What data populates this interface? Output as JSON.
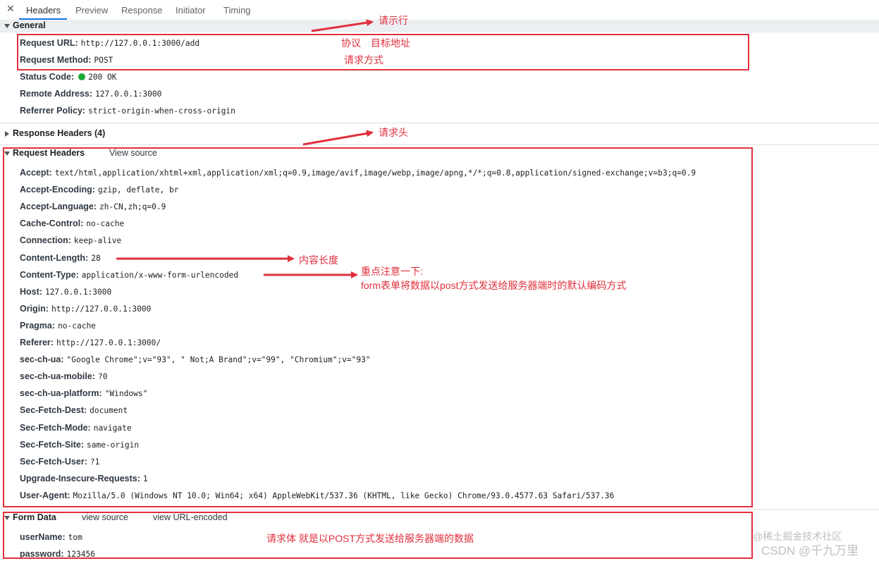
{
  "tabs": {
    "close_glyph": "✕",
    "items": [
      "Headers",
      "Preview",
      "Response",
      "Initiator",
      "Timing"
    ]
  },
  "general": {
    "title": "General",
    "rows": [
      {
        "key": "Request URL:",
        "value": "http://127.0.0.1:3000/add"
      },
      {
        "key": "Request Method:",
        "value": "POST"
      },
      {
        "key": "Status Code:",
        "value": "200 OK"
      },
      {
        "key": "Remote Address:",
        "value": "127.0.0.1:3000"
      },
      {
        "key": "Referrer Policy:",
        "value": "strict-origin-when-cross-origin"
      }
    ]
  },
  "response_headers": {
    "title": "Response Headers (4)"
  },
  "request_headers": {
    "title": "Request Headers",
    "view_source": "View source",
    "rows": [
      {
        "key": "Accept:",
        "value": "text/html,application/xhtml+xml,application/xml;q=0.9,image/avif,image/webp,image/apng,*/*;q=0.8,application/signed-exchange;v=b3;q=0.9"
      },
      {
        "key": "Accept-Encoding:",
        "value": "gzip, deflate, br"
      },
      {
        "key": "Accept-Language:",
        "value": "zh-CN,zh;q=0.9"
      },
      {
        "key": "Cache-Control:",
        "value": "no-cache"
      },
      {
        "key": "Connection:",
        "value": "keep-alive"
      },
      {
        "key": "Content-Length:",
        "value": "28"
      },
      {
        "key": "Content-Type:",
        "value": "application/x-www-form-urlencoded"
      },
      {
        "key": "Host:",
        "value": "127.0.0.1:3000"
      },
      {
        "key": "Origin:",
        "value": "http://127.0.0.1:3000"
      },
      {
        "key": "Pragma:",
        "value": "no-cache"
      },
      {
        "key": "Referer:",
        "value": "http://127.0.0.1:3000/"
      },
      {
        "key": "sec-ch-ua:",
        "value": "\"Google Chrome\";v=\"93\", \" Not;A Brand\";v=\"99\", \"Chromium\";v=\"93\""
      },
      {
        "key": "sec-ch-ua-mobile:",
        "value": "?0"
      },
      {
        "key": "sec-ch-ua-platform:",
        "value": "\"Windows\""
      },
      {
        "key": "Sec-Fetch-Dest:",
        "value": "document"
      },
      {
        "key": "Sec-Fetch-Mode:",
        "value": "navigate"
      },
      {
        "key": "Sec-Fetch-Site:",
        "value": "same-origin"
      },
      {
        "key": "Sec-Fetch-User:",
        "value": "?1"
      },
      {
        "key": "Upgrade-Insecure-Requests:",
        "value": "1"
      },
      {
        "key": "User-Agent:",
        "value": "Mozilla/5.0 (Windows NT 10.0; Win64; x64) AppleWebKit/537.36 (KHTML, like Gecko) Chrome/93.0.4577.63 Safari/537.36"
      }
    ]
  },
  "form_data": {
    "title": "Form Data",
    "view_source": "view source",
    "view_url_encoded": "view URL-encoded",
    "rows": [
      {
        "key": "userName:",
        "value": "tom"
      },
      {
        "key": "password:",
        "value": "123456"
      }
    ]
  },
  "annotations": {
    "request_line": "请示行",
    "protocol_target": "协议　目标地址",
    "method": "请求方式",
    "request_header": "请求头",
    "content_length": "内容长度",
    "content_type_note1": "重点注意一下:",
    "content_type_note2": "form表单将数据以post方式发送给服务器端时的默认编码方式",
    "request_body": "请求体  就是以POST方式发送给服务器端的数据"
  },
  "watermark": {
    "line1": "@稀土掘金技术社区",
    "line2": "CSDN @千九万里"
  },
  "colors": {
    "annotation_red": "#e0303d",
    "status_green": "#1fa83a",
    "tab_accent": "#1a73e8"
  }
}
